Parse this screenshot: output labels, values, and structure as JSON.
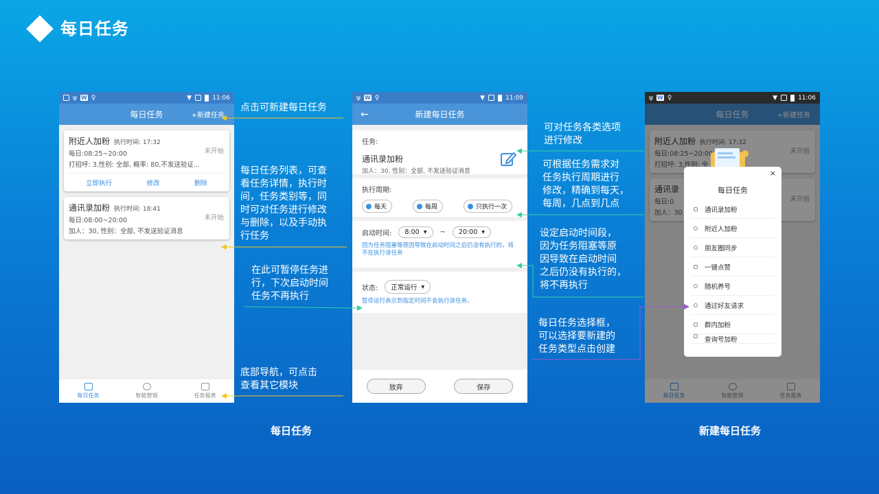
{
  "slide_title": "每日任务",
  "status_left": {
    "time1": "11:06",
    "time2": "11:09",
    "time3": "11:06",
    "w": "W"
  },
  "phone1": {
    "title": "每日任务",
    "action": "+新建任务",
    "cards": [
      {
        "title": "附近人加粉",
        "exec": "执行时间: 17:32",
        "line1": "每日:08:25~20:00",
        "line2": "打招呼: 3,性别: 全部, 概率: 80,不发送验证...",
        "status": "未开始",
        "actions": [
          "立即执行",
          "修改",
          "删除"
        ]
      },
      {
        "title": "通讯录加粉",
        "exec": "执行时间: 18:41",
        "line1": "每日:08:00~20:00",
        "line2": "加人：30, 性别：全部, 不发送验证消息",
        "status": "未开始"
      }
    ],
    "tabs": [
      "每日任务",
      "智能营销",
      "任务报表"
    ]
  },
  "phone2": {
    "title": "新建每日任务",
    "back": "←",
    "task_label": "任务:",
    "task_name": "通讯录加粉",
    "task_desc": "加人：30, 性别：全部, 不发送验证消息",
    "period_label": "执行周期:",
    "periods": [
      "每天",
      "每周",
      "只执行一次"
    ],
    "start_label": "启动时间:",
    "start_from": "8:00",
    "start_sep": "~",
    "start_to": "20:00",
    "start_hint": "因为任务阻塞等原因导致在启动时间之后仍没有执行的，将不在执行该任务",
    "state_label": "状态:",
    "state_value": "正常运行",
    "state_hint": "暂停运行表示到指定时间不会执行该任务。",
    "cancel": "放弃",
    "save": "保存"
  },
  "phone3": {
    "title": "每日任务",
    "action": "+新建任务",
    "bg_cards": [
      {
        "title": "附近人加粉",
        "exec": "执行时间: 17:32",
        "line1": "每日:08:25~20:00",
        "line2": "打招呼: 3,性别: 全",
        "status": "未开始"
      },
      {
        "title": "通讯录",
        "line1": "每日:0",
        "line2": "加人：30",
        "status": "未开始"
      }
    ],
    "dialog_title": "每日任务",
    "dialog_close": "×",
    "dialog_items": [
      "通讯录加粉",
      "附近人加粉",
      "朋友圈同步",
      "一键点赞",
      "随机养号",
      "通过好友请求",
      "群内加粉",
      "查询号加粉"
    ],
    "tabs": [
      "每日任务",
      "智能营销",
      "任务报表"
    ]
  },
  "annotations": {
    "a1": "点击可新建每日任务",
    "a2": [
      "每日任务列表，可查",
      "看任务详情，执行时",
      "间，任务类别等，同",
      "时可对任务进行修改",
      "与删除，以及手动执",
      "行任务"
    ],
    "a3": [
      "在此可暂停任务进",
      "行，下次启动时间",
      "任务不再执行"
    ],
    "a4": [
      "底部导航，可点击",
      "查看其它模块"
    ],
    "a5": [
      "可对任务各类选项",
      "进行修改"
    ],
    "a6": [
      "可根据任务需求对",
      "任务执行周期进行",
      "修改，精确到每天，",
      "每周，几点到几点"
    ],
    "a7": [
      "设定启动时间段，",
      "因为任务阻塞等原",
      "因导致在启动时间",
      "之后仍没有执行的，",
      "将不再执行"
    ],
    "a8": [
      "每日任务选择框，",
      "可以选择要新建的",
      "任务类型点击创建"
    ]
  },
  "captions": {
    "left": "每日任务",
    "right": "新建每日任务"
  },
  "colors": {
    "accent": "#3a8fe0",
    "appbar": "#4a94d9",
    "line_yellow": "#f5c518",
    "line_green": "#36d0a0",
    "line_purple": "#9b59d0"
  }
}
